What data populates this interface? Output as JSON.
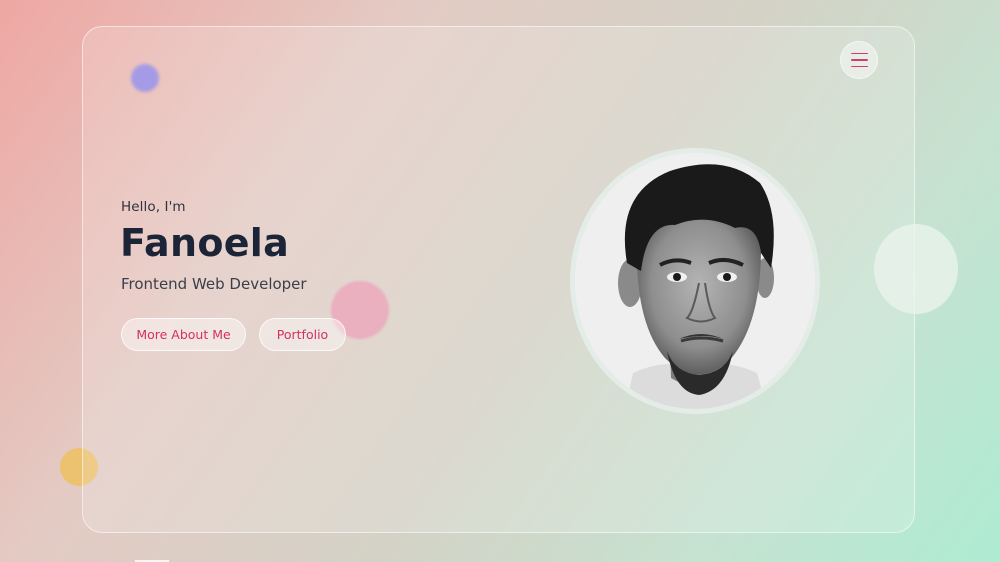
{
  "hero": {
    "greeting": "Hello, I'm",
    "name": "Fanoela",
    "role": "Frontend Web Developer"
  },
  "buttons": {
    "about_label": "More About Me",
    "portfolio_label": "Portfolio"
  },
  "menu": {
    "icon": "hamburger-menu-icon"
  },
  "profile_photo": {
    "alt": "Profile photo"
  },
  "colors": {
    "accent": "#d2325f",
    "heading": "#1c2537"
  }
}
